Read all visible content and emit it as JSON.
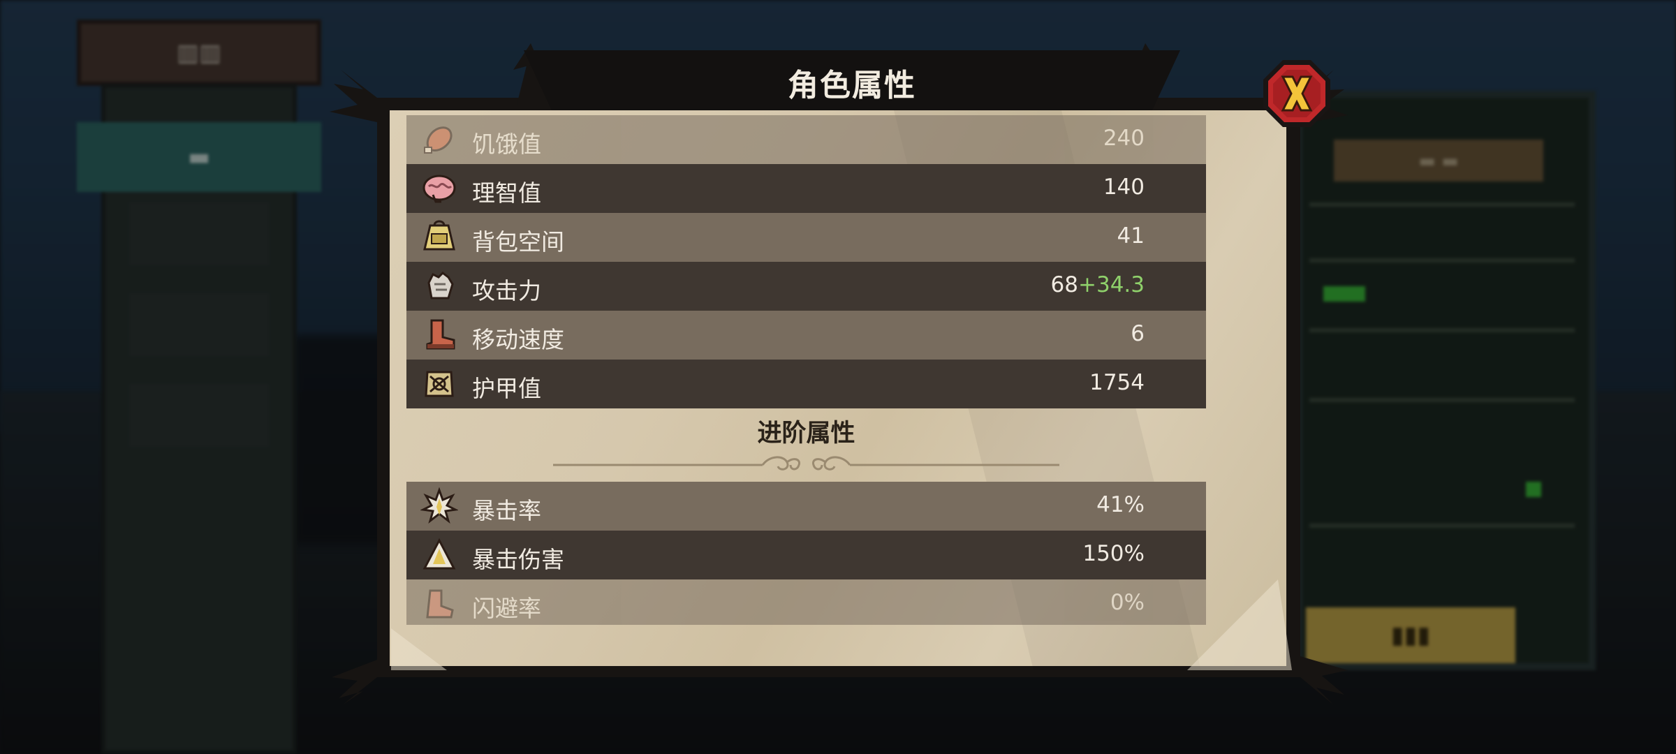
{
  "dialog": {
    "title": "角色属性",
    "close_label": "X"
  },
  "basic_stats": [
    {
      "icon": "meat-icon",
      "name": "饥饿值",
      "value": "240",
      "bonus": "",
      "faded": true
    },
    {
      "icon": "brain-icon",
      "name": "理智值",
      "value": "140",
      "bonus": "",
      "faded": false
    },
    {
      "icon": "backpack-icon",
      "name": "背包空间",
      "value": "41",
      "bonus": "",
      "faded": false
    },
    {
      "icon": "fist-icon",
      "name": "攻击力",
      "value": "68",
      "bonus": "+34.3",
      "faded": false
    },
    {
      "icon": "boot-icon",
      "name": "移动速度",
      "value": "6",
      "bonus": "",
      "faded": false
    },
    {
      "icon": "armor-icon",
      "name": "护甲值",
      "value": "1754",
      "bonus": "",
      "faded": false
    }
  ],
  "advanced_section": {
    "title": "进阶属性"
  },
  "advanced_stats": [
    {
      "icon": "critical-hit-icon",
      "name": "暴击率",
      "value": "41%",
      "faded": false
    },
    {
      "icon": "critical-damage-icon",
      "name": "暴击伤害",
      "value": "150%",
      "faded": false
    },
    {
      "icon": "dodge-icon",
      "name": "闪避率",
      "value": "0%",
      "faded": true
    }
  ],
  "colors": {
    "row_light": "#786c5e",
    "row_dark": "#3f3731",
    "bonus_text": "#8fd16b",
    "close_button": "#c0282a",
    "close_x": "#f3c43a"
  }
}
